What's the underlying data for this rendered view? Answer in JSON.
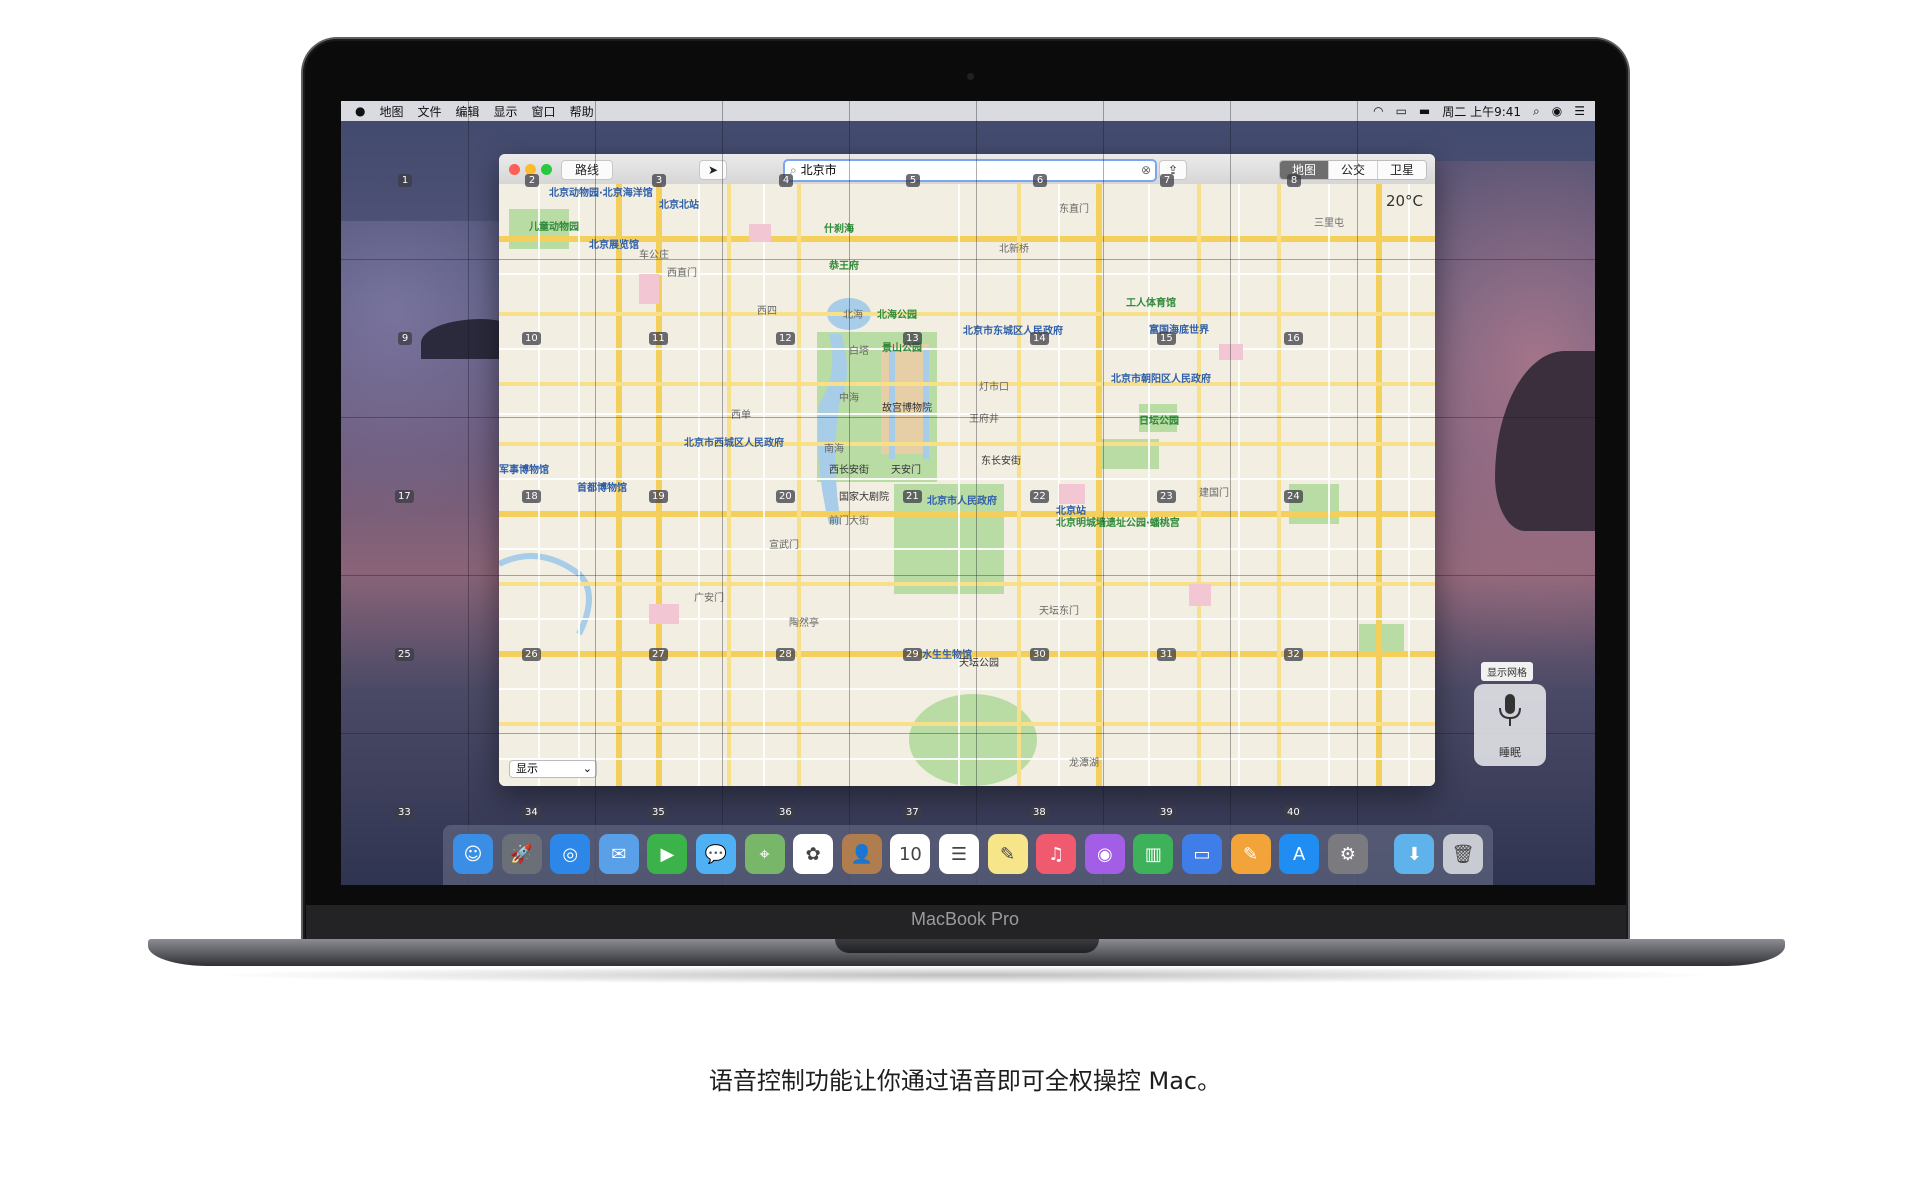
{
  "laptop": {
    "brand": "MacBook Pro"
  },
  "menubar": {
    "apple": "",
    "items": [
      "地图",
      "文件",
      "编辑",
      "显示",
      "窗口",
      "帮助"
    ],
    "clock": "周二 上午9:41"
  },
  "maps": {
    "route_button": "路线",
    "search_value": "北京市",
    "view_modes": [
      "地图",
      "公交",
      "卫星"
    ],
    "weather": "20°C",
    "show_select": "显示",
    "pois": [
      {
        "label": "北京动物园·北京海洋馆",
        "cls": "blue"
      },
      {
        "label": "北京北站",
        "cls": "blue"
      },
      {
        "label": "儿童动物园",
        "cls": "green"
      },
      {
        "label": "北京展览馆",
        "cls": "blue"
      },
      {
        "label": "什刹海",
        "cls": "green"
      },
      {
        "label": "恭王府",
        "cls": "green"
      },
      {
        "label": "北海",
        "cls": "grey"
      },
      {
        "label": "北海公园",
        "cls": "green"
      },
      {
        "label": "景山公园",
        "cls": "green"
      },
      {
        "label": "白塔",
        "cls": "grey"
      },
      {
        "label": "中海",
        "cls": "grey"
      },
      {
        "label": "故宫博物院",
        "cls": "dark"
      },
      {
        "label": "南海",
        "cls": "grey"
      },
      {
        "label": "西长安街",
        "cls": "dark"
      },
      {
        "label": "天安门",
        "cls": "dark"
      },
      {
        "label": "国家大剧院",
        "cls": "dark"
      },
      {
        "label": "北京市人民政府",
        "cls": "blue"
      },
      {
        "label": "北京市西城区人民政府",
        "cls": "blue"
      },
      {
        "label": "北京市东城区人民政府",
        "cls": "blue"
      },
      {
        "label": "北京市朝阳区人民政府",
        "cls": "blue"
      },
      {
        "label": "工人体育馆",
        "cls": "green"
      },
      {
        "label": "富国海底世界",
        "cls": "blue"
      },
      {
        "label": "日坛公园",
        "cls": "green"
      },
      {
        "label": "北京站",
        "cls": "blue"
      },
      {
        "label": "北京明城墙遗址公园·蟠桃宫",
        "cls": "green"
      },
      {
        "label": "军事博物馆",
        "cls": "blue"
      },
      {
        "label": "首都博物馆",
        "cls": "blue"
      },
      {
        "label": "水生生物馆",
        "cls": "blue"
      },
      {
        "label": "天坛公园",
        "cls": "dark"
      },
      {
        "label": "东长安街",
        "cls": "dark"
      },
      {
        "label": "前门大街",
        "cls": "grey"
      },
      {
        "label": "灯市口",
        "cls": "grey"
      },
      {
        "label": "王府井",
        "cls": "grey"
      },
      {
        "label": "西四",
        "cls": "grey"
      },
      {
        "label": "西单",
        "cls": "grey"
      },
      {
        "label": "宣武门",
        "cls": "grey"
      },
      {
        "label": "广安门",
        "cls": "grey"
      },
      {
        "label": "陶然亭",
        "cls": "grey"
      },
      {
        "label": "天坛东门",
        "cls": "grey"
      },
      {
        "label": "龙潭湖",
        "cls": "grey"
      },
      {
        "label": "三里屯",
        "cls": "grey"
      },
      {
        "label": "东直门",
        "cls": "grey"
      },
      {
        "label": "建国门",
        "cls": "grey"
      },
      {
        "label": "北新桥",
        "cls": "grey"
      },
      {
        "label": "西直门",
        "cls": "grey"
      },
      {
        "label": "车公庄",
        "cls": "grey"
      }
    ]
  },
  "grid_labels": [
    "1",
    "2",
    "3",
    "4",
    "5",
    "6",
    "7",
    "8",
    "9",
    "10",
    "11",
    "12",
    "13",
    "14",
    "15",
    "16",
    "17",
    "18",
    "19",
    "20",
    "21",
    "22",
    "23",
    "24",
    "25",
    "26",
    "27",
    "28",
    "29",
    "30",
    "31",
    "32",
    "33",
    "34",
    "35",
    "36",
    "37",
    "38",
    "39",
    "40"
  ],
  "voice": {
    "tooltip": "显示网格",
    "label": "睡眠"
  },
  "dock": {
    "apps": [
      {
        "name": "finder-icon",
        "bg": "#3a8ee6",
        "glyph": "☺"
      },
      {
        "name": "launchpad-icon",
        "bg": "#6b6f78",
        "glyph": "🚀"
      },
      {
        "name": "safari-icon",
        "bg": "#2d87e8",
        "glyph": "◎"
      },
      {
        "name": "mail-icon",
        "bg": "#5aa0e8",
        "glyph": "✉"
      },
      {
        "name": "facetime-icon",
        "bg": "#3bb34a",
        "glyph": "▶"
      },
      {
        "name": "messages-icon",
        "bg": "#4fb1f4",
        "glyph": "💬"
      },
      {
        "name": "maps-icon",
        "bg": "#78b76a",
        "glyph": "⌖"
      },
      {
        "name": "photos-icon",
        "bg": "#ffffff",
        "glyph": "✿"
      },
      {
        "name": "contacts-icon",
        "bg": "#b07d4f",
        "glyph": "👤"
      },
      {
        "name": "calendar-icon",
        "bg": "#ffffff",
        "glyph": "10"
      },
      {
        "name": "reminders-icon",
        "bg": "#ffffff",
        "glyph": "☰"
      },
      {
        "name": "notes-icon",
        "bg": "#f7e58a",
        "glyph": "✎"
      },
      {
        "name": "music-icon",
        "bg": "#f05a6e",
        "glyph": "♫"
      },
      {
        "name": "podcasts-icon",
        "bg": "#a35ee6",
        "glyph": "◉"
      },
      {
        "name": "numbers-icon",
        "bg": "#3db25a",
        "glyph": "▥"
      },
      {
        "name": "keynote-icon",
        "bg": "#3f7ee8",
        "glyph": "▭"
      },
      {
        "name": "pages-icon",
        "bg": "#f2a33a",
        "glyph": "✎"
      },
      {
        "name": "app-store-icon",
        "bg": "#1f8df2",
        "glyph": "A"
      },
      {
        "name": "system-preferences-icon",
        "bg": "#7a7a7f",
        "glyph": "⚙"
      },
      {
        "name": "downloads-folder-icon",
        "bg": "#5fb3ea",
        "glyph": "⬇"
      },
      {
        "name": "trash-icon",
        "bg": "#c8ccd2",
        "glyph": "🗑"
      }
    ]
  },
  "caption": "语音控制功能让你通过语音即可全权操控 Mac。"
}
